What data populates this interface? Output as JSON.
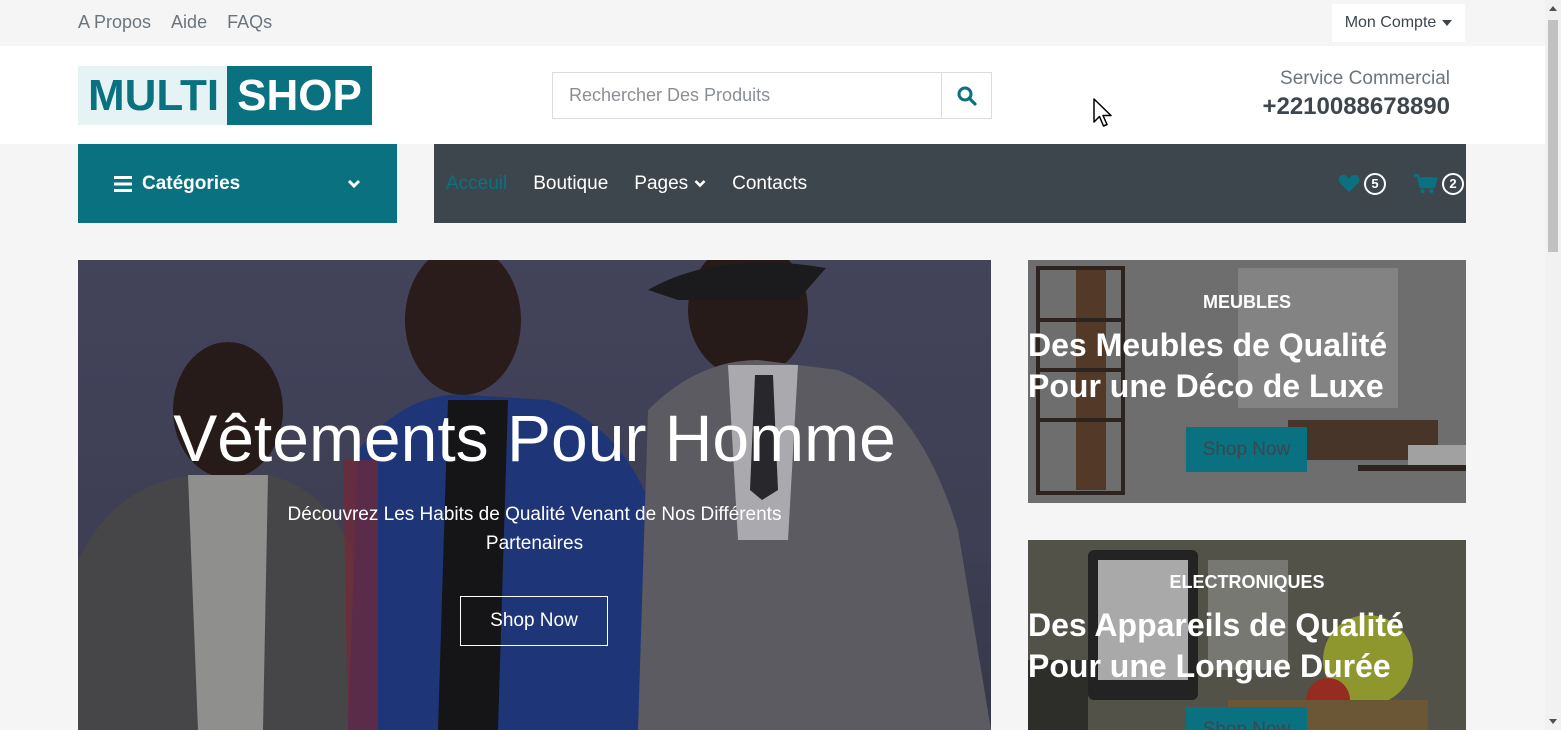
{
  "topbar": {
    "links": [
      "A Propos",
      "Aide",
      "FAQs"
    ],
    "account_label": "Mon Compte"
  },
  "header": {
    "logo_part1": "MULTI",
    "logo_part2": "SHOP",
    "search_placeholder": "Rechercher Des Produits",
    "service_label": "Service Commercial",
    "service_phone": "+2210088678890"
  },
  "nav": {
    "categories_label": "Catégories",
    "items": [
      "Acceuil",
      "Boutique",
      "Pages",
      "Contacts"
    ],
    "active_item": "Acceuil",
    "wishlist_count": "5",
    "cart_count": "2"
  },
  "hero": {
    "title": "Vêtements Pour Homme",
    "subtitle": "Découvrez Les Habits de Qualité Venant de Nos Différents Partenaires",
    "button": "Shop Now"
  },
  "promos": [
    {
      "tag": "MEUBLES",
      "title_line1": "Des Meubles de Qualité",
      "title_line2": "Pour une Déco de Luxe",
      "button": "Shop Now"
    },
    {
      "tag": "ELECTRONIQUES",
      "title_line1": "Des Appareils de Qualité",
      "title_line2": "Pour une Longue Durée",
      "button": "Shop Now"
    }
  ],
  "colors": {
    "primary": "#0a7180",
    "dark": "#3d464d",
    "light_bg": "#f5f5f5"
  },
  "icons": [
    "bars-icon",
    "chevron-down-icon",
    "search-icon",
    "heart-icon",
    "cart-icon",
    "caret-down-icon",
    "mouse-cursor-icon"
  ]
}
